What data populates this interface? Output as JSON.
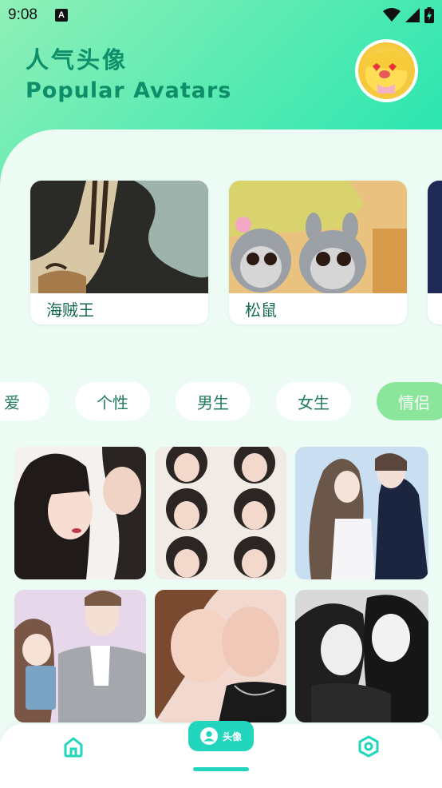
{
  "status_bar": {
    "time": "9:08",
    "notification_icon": "a-letter-icon",
    "icons": [
      "wifi-icon",
      "signal-icon",
      "battery-icon"
    ]
  },
  "header": {
    "title_cn": "人气头像",
    "title_en": "Popular Avatars",
    "avatar_icon": "cartoon-avatar"
  },
  "featured": [
    {
      "label": "海贼王"
    },
    {
      "label": "松鼠"
    }
  ],
  "categories": [
    {
      "label": "爱",
      "active": false
    },
    {
      "label": "个性",
      "active": false
    },
    {
      "label": "男生",
      "active": false
    },
    {
      "label": "女生",
      "active": false
    },
    {
      "label": "情侣",
      "active": true
    }
  ],
  "grid": {
    "items": [
      "couple-avatar-1",
      "couple-avatar-2",
      "couple-avatar-3",
      "couple-avatar-4",
      "couple-avatar-5",
      "couple-avatar-6"
    ]
  },
  "bottom_nav": {
    "home_icon": "home-icon",
    "center_label": "头像",
    "center_icon": "user-icon",
    "settings_icon": "settings-hexagon-icon"
  },
  "colors": {
    "accent": "#21d6bd",
    "title_green": "#0e8f6a",
    "panel_bg": "#ecfcf4",
    "chip_active": "#8be59b"
  }
}
